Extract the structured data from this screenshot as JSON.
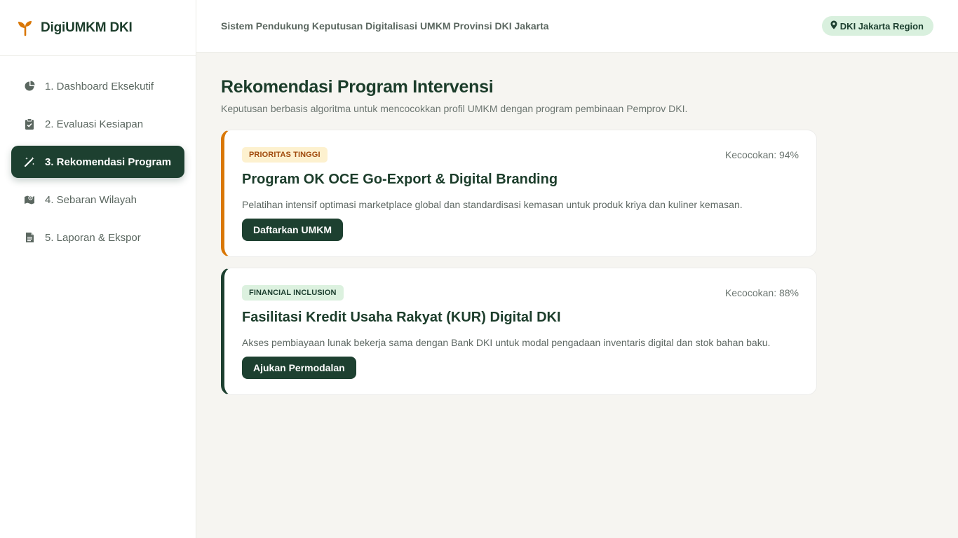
{
  "app": {
    "name": "DigiUMKM DKI",
    "brand_color": "#d97706"
  },
  "sidebar": {
    "items": [
      {
        "label": "1. Dashboard Eksekutif",
        "icon": "pie-chart-icon",
        "active": false
      },
      {
        "label": "2. Evaluasi Kesiapan",
        "icon": "clipboard-check-icon",
        "active": false
      },
      {
        "label": "3. Rekomendasi Program",
        "icon": "magic-wand-icon",
        "active": true
      },
      {
        "label": "4. Sebaran Wilayah",
        "icon": "map-icon",
        "active": false
      },
      {
        "label": "5. Laporan & Ekspor",
        "icon": "file-icon",
        "active": false
      }
    ]
  },
  "header": {
    "title": "Sistem Pendukung Keputusan Digitalisasi UMKM Provinsi DKI Jakarta",
    "region_badge": "DKI Jakarta Region"
  },
  "main": {
    "title": "Rekomendasi Program Intervensi",
    "subtitle": "Keputusan berbasis algoritma untuk mencocokkan profil UMKM dengan program pembinaan Pemprov DKI.",
    "cards": [
      {
        "tag": "PRIORITAS TINGGI",
        "match": "Kecocokan: 94%",
        "title": "Program OK OCE Go-Export & Digital Branding",
        "description": "Pelatihan intensif optimasi marketplace global dan standardisasi kemasan untuk produk kriya dan kuliner kemasan.",
        "button": "Daftarkan UMKM",
        "accent": "#d97706"
      },
      {
        "tag": "FINANCIAL INCLUSION",
        "match": "Kecocokan: 88%",
        "title": "Fasilitasi Kredit Usaha Rakyat (KUR) Digital DKI",
        "description": "Akses pembiayaan lunak bekerja sama dengan Bank DKI untuk modal pengadaan inventaris digital dan stok bahan baku.",
        "button": "Ajukan Permodalan",
        "accent": "#1d4030"
      }
    ]
  }
}
